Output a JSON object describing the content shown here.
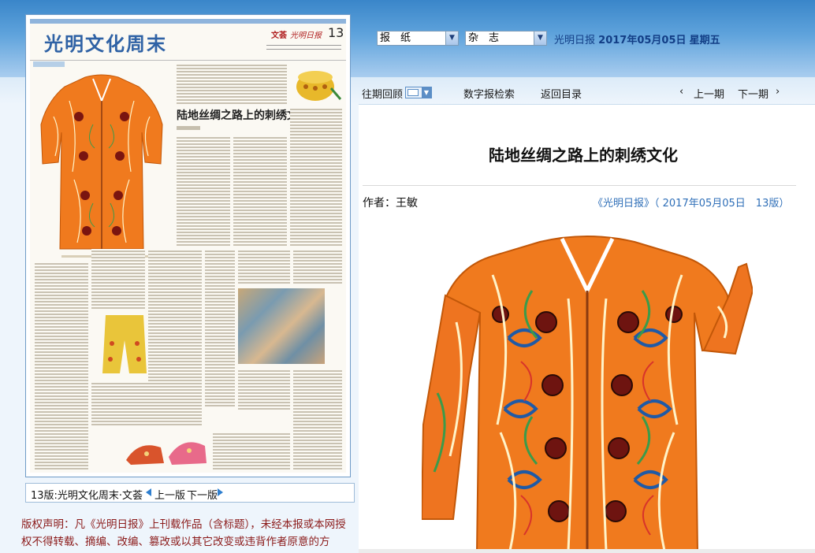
{
  "newspaper_page": {
    "masthead_title": "光明文化周末",
    "section": "文荟",
    "brand": "光明日报",
    "page_number": "13",
    "article_title": "陆地丝绸之路上的刺绣文化"
  },
  "toolbar": {
    "select_newspaper": "报　纸",
    "select_magazine": "杂　志",
    "paper_name": "光明日报",
    "date": "2017年05月05日",
    "weekday": "星期五"
  },
  "nav": {
    "past_review": "往期回顾",
    "digital_search": "数字报检索",
    "back_to_index": "返回目录",
    "prev_issue": "上一期",
    "next_issue": "下一期"
  },
  "article": {
    "title": "陆地丝绸之路上的刺绣文化",
    "author": "作者：王敏",
    "source": "《光明日报》（ 2017年05月05日　13版）"
  },
  "page_selector": {
    "label": "13版:光明文化周末·文荟",
    "prev": "上一版",
    "next": "下一版"
  },
  "copyright": "版权声明：凡《光明日报》上刊载作品（含标题），未经本报或本网授权不得转载、摘编、改编、篡改或以其它改变或违背作者原意的方",
  "colors": {
    "banner_top": "#3a86c9",
    "link_blue": "#2f6fb8",
    "copyright_red": "#8b1a1a",
    "coat_orange": "#f07a1e"
  },
  "icons": {
    "past_review_calendar": "calendar-dropdown-icon",
    "prev_arrow": "chevron-left-icon",
    "next_arrow": "chevron-right-icon"
  }
}
